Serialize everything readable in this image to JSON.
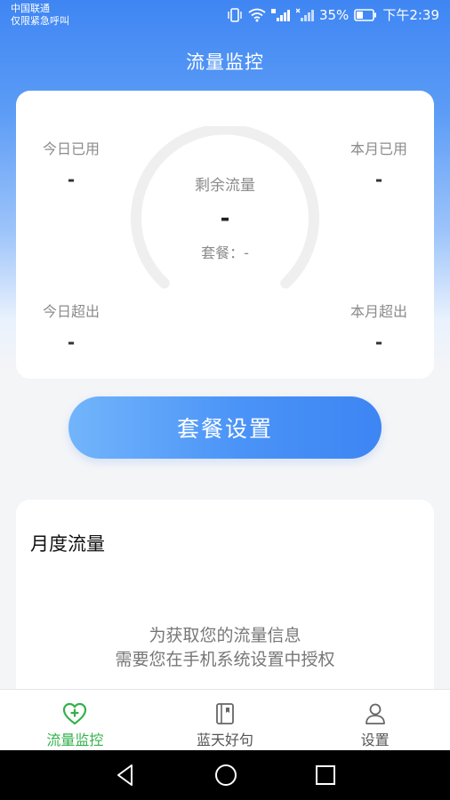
{
  "status_bar": {
    "carrier": "中国联通",
    "emergency": "仅限紧急呼叫",
    "battery": "35%",
    "time": "下午2:39"
  },
  "header": {
    "title": "流量监控"
  },
  "usage_card": {
    "today_used_label": "今日已用",
    "today_used_value": "-",
    "month_used_label": "本月已用",
    "month_used_value": "-",
    "today_over_label": "今日超出",
    "today_over_value": "-",
    "month_over_label": "本月超出",
    "month_over_value": "-",
    "remaining_label": "剩余流量",
    "remaining_value": "-",
    "plan_text": "套餐：-"
  },
  "plan_button": {
    "label": "套餐设置"
  },
  "monthly": {
    "title": "月度流量",
    "message_line1": "为获取您的流量信息",
    "message_line2": "需要您在手机系统设置中授权"
  },
  "tabs": [
    {
      "label": "流量监控",
      "icon": "heart-plus-icon",
      "active": true
    },
    {
      "label": "蓝天好句",
      "icon": "notebook-icon",
      "active": false
    },
    {
      "label": "设置",
      "icon": "person-icon",
      "active": false
    }
  ],
  "colors": {
    "accent": "#3d85f3",
    "active_tab": "#34b14b"
  }
}
